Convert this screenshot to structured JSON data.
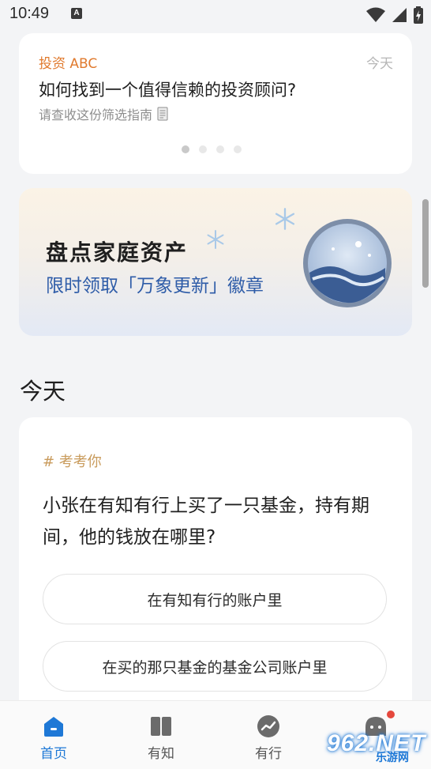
{
  "status_bar": {
    "time": "10:49",
    "notification_icon": "A"
  },
  "article_card": {
    "source": "投资 ABC",
    "date": "今天",
    "title": "如何找到一个值得信赖的投资顾问?",
    "subtitle": "请查收这份筛选指南",
    "subtitle_icon": "memo-icon",
    "carousel_active_index": 0,
    "carousel_count": 4
  },
  "banner": {
    "title": "盘点家庭资产",
    "subtitle": "限时领取「万象更新」徽章",
    "badge_icon": "2026-badge-icon"
  },
  "section": {
    "title": "今天"
  },
  "quiz_card": {
    "tag": "# 考考你",
    "question": "小张在有知有行上买了一只基金，持有期间，他的钱放在哪里?",
    "options": [
      "在有知有行的账户里",
      "在买的那只基金的基金公司账户里"
    ]
  },
  "tab_bar": {
    "tabs": [
      {
        "label": "首页",
        "icon": "home-icon",
        "active": true
      },
      {
        "label": "有知",
        "icon": "book-icon",
        "active": false
      },
      {
        "label": "有行",
        "icon": "trend-icon",
        "active": false
      },
      {
        "label": "",
        "icon": "profile-icon",
        "active": false,
        "notification_dot": true
      }
    ]
  },
  "watermark": {
    "big": "962.NET",
    "small": "乐游网"
  },
  "colors": {
    "accent": "#1e78d6",
    "source_orange": "#e07a2e",
    "tag_gold": "#c99b5c",
    "banner_blue": "#2e5ca8"
  }
}
